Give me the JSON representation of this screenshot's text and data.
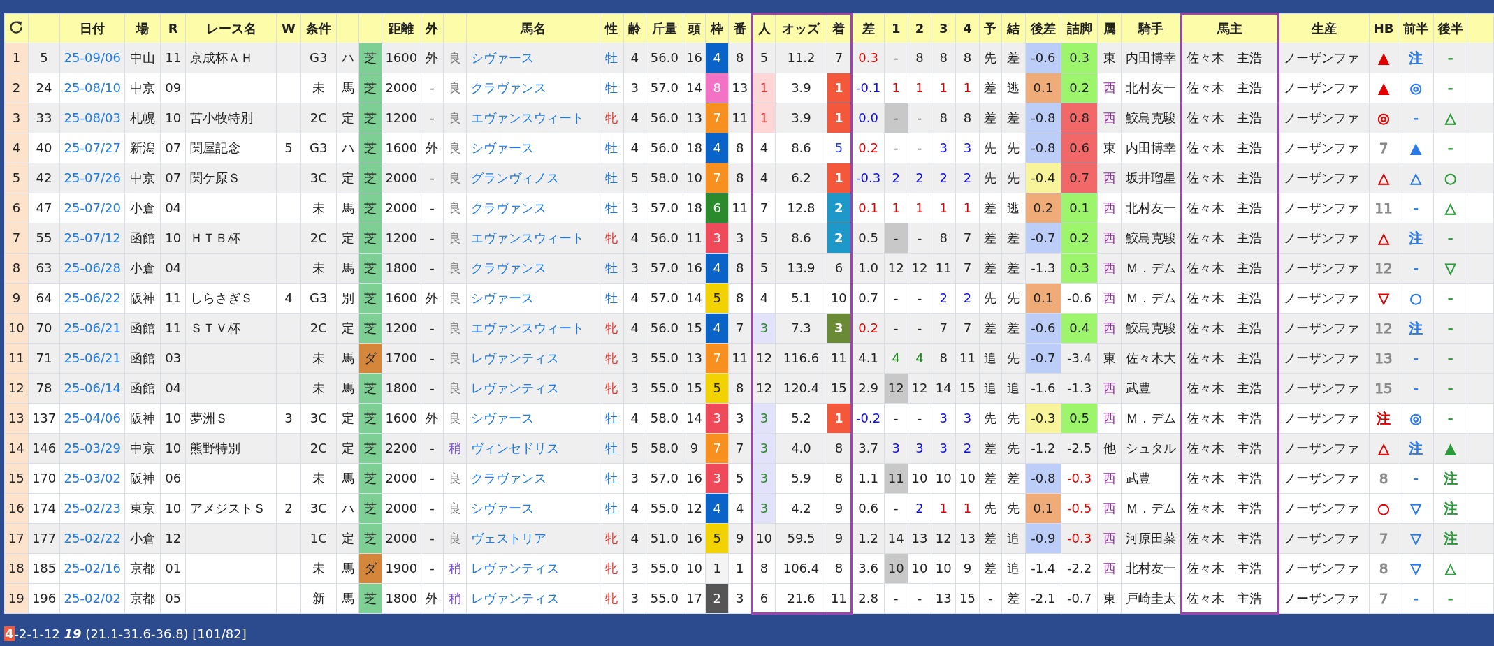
{
  "columns": [
    {
      "kind": "index",
      "highlighted": false
    },
    {
      "kind": "cell",
      "highlighted": false
    },
    {
      "label": "日付",
      "kind": "date-link",
      "highlighted": false
    },
    {
      "label": "場",
      "kind": "cell",
      "highlighted": false
    },
    {
      "label": "R",
      "kind": "cell",
      "highlighted": false
    },
    {
      "label": "レース名",
      "kind": "name",
      "highlighted": false
    },
    {
      "label": "W",
      "kind": "cell",
      "highlighted": false
    },
    {
      "label": "条件",
      "kind": "cell",
      "highlighted": false
    },
    {
      "kind": "cell",
      "highlighted": false
    },
    {
      "kind": "cell",
      "highlighted": false
    },
    {
      "label": "距離",
      "kind": "cell",
      "highlighted": false
    },
    {
      "label": "外",
      "kind": "cell",
      "highlighted": false
    },
    {
      "kind": "cell",
      "highlighted": false
    },
    {
      "label": "馬名",
      "kind": "horse-link",
      "highlighted": false
    },
    {
      "label": "性",
      "kind": "cell",
      "highlighted": false
    },
    {
      "label": "齢",
      "kind": "cell",
      "highlighted": false
    },
    {
      "label": "斤量",
      "kind": "cell",
      "highlighted": false
    },
    {
      "label": "頭",
      "kind": "cell",
      "highlighted": false
    },
    {
      "label": "枠",
      "kind": "cell",
      "highlighted": false
    },
    {
      "label": "番",
      "kind": "cell",
      "highlighted": false
    },
    {
      "label": "人",
      "kind": "cell",
      "highlighted": true
    },
    {
      "label": "オッズ",
      "kind": "cell",
      "highlighted": true
    },
    {
      "label": "着",
      "kind": "cell",
      "highlighted": true
    },
    {
      "label": "差",
      "kind": "cell",
      "highlighted": false
    },
    {
      "label": "1",
      "kind": "cell",
      "highlighted": false
    },
    {
      "label": "2",
      "kind": "cell",
      "highlighted": false
    },
    {
      "label": "3",
      "kind": "cell",
      "highlighted": false
    },
    {
      "label": "4",
      "kind": "cell",
      "highlighted": false
    },
    {
      "label": "予",
      "kind": "cell",
      "highlighted": false
    },
    {
      "label": "結",
      "kind": "cell",
      "highlighted": false
    },
    {
      "label": "後差",
      "kind": "cell",
      "highlighted": false
    },
    {
      "label": "詰脚",
      "kind": "cell",
      "highlighted": false
    },
    {
      "label": "属",
      "kind": "cell",
      "highlighted": false
    },
    {
      "label": "騎手",
      "kind": "name",
      "highlighted": false
    },
    {
      "label": "馬主",
      "kind": "name",
      "highlighted": true
    },
    {
      "label": "生産",
      "kind": "name",
      "highlighted": false
    },
    {
      "label": "HB",
      "kind": "symbol",
      "highlighted": false
    },
    {
      "label": "前半",
      "kind": "symbol",
      "highlighted": false
    },
    {
      "label": "後半",
      "kind": "symbol",
      "highlighted": false
    }
  ],
  "rows": [
    {
      "shaded": true,
      "cells": [
        "1",
        "5",
        "25-09/06",
        "中山",
        "11",
        "京成杯ＡＨ",
        null,
        "G3",
        "ハ",
        {
          "text": "芝",
          "fill": {
            "color": "#7dcf94"
          }
        },
        "1600",
        "外",
        {
          "text": "良",
          "color": "#777777"
        },
        "シヴァース",
        {
          "text": "牡",
          "color": "#1a73e8"
        },
        "4",
        "56.0",
        "16",
        {
          "text": "4",
          "kind": "inverse",
          "fill": {
            "color": "#0a63c9"
          }
        },
        "8",
        "5",
        "11.2",
        "7",
        {
          "text": "0.3",
          "color": "#e00000"
        },
        "-",
        "8",
        "8",
        "8",
        "先",
        "差",
        {
          "text": "-0.6",
          "fill": {
            "color": "#bccdf7"
          }
        },
        {
          "text": "0.3",
          "fill": {
            "color": "#9cf56a"
          }
        },
        "東",
        "内田博幸",
        "佐々木　主浩",
        "ノーザンファ",
        {
          "text": "▲",
          "color": "#e00000"
        },
        {
          "text": "注",
          "color": "#2a7ae8"
        },
        {
          "text": "-",
          "color": "#2a9a3a"
        }
      ]
    },
    {
      "shaded": false,
      "cells": [
        "2",
        "24",
        "25-08/10",
        "中京",
        "09",
        null,
        null,
        "未",
        "馬",
        {
          "text": "芝",
          "fill": {
            "color": "#7dcf94"
          }
        },
        "2000",
        "-",
        {
          "text": "良",
          "color": "#777777"
        },
        "クラヴァンス",
        {
          "text": "牡",
          "color": "#1a73e8"
        },
        "3",
        "57.0",
        "14",
        {
          "text": "8",
          "kind": "inverse",
          "fill": {
            "color": "#f472c6"
          }
        },
        "13",
        {
          "text": "1",
          "color": "#e53935",
          "fill": {
            "color": "#ffd6d6"
          }
        },
        "3.9",
        {
          "text": "1",
          "kind": "inverse",
          "fill": {
            "color": "#f4583a"
          }
        },
        {
          "text": "-0.1",
          "color": "#1010e0"
        },
        {
          "text": "1",
          "color": "#e00000"
        },
        {
          "text": "1",
          "color": "#e00000"
        },
        {
          "text": "1",
          "color": "#e00000"
        },
        {
          "text": "1",
          "color": "#e00000"
        },
        "差",
        "逃",
        {
          "text": "0.1",
          "fill": {
            "color": "#f0ac78"
          }
        },
        {
          "text": "0.2",
          "fill": {
            "color": "#9cf56a"
          }
        },
        {
          "text": "西",
          "color": "#8e2f9a"
        },
        "北村友一",
        "佐々木　主浩",
        "ノーザンファ",
        {
          "text": "▲",
          "color": "#e00000"
        },
        {
          "text": "◎",
          "color": "#2a7ae8"
        },
        {
          "text": "-",
          "color": "#2a9a3a"
        }
      ]
    },
    {
      "shaded": true,
      "cells": [
        "3",
        "33",
        "25-08/03",
        "札幌",
        "10",
        "苫小牧特別",
        null,
        "2C",
        "定",
        {
          "text": "芝",
          "fill": {
            "color": "#7dcf94"
          }
        },
        "1200",
        "-",
        {
          "text": "良",
          "color": "#777777"
        },
        "エヴァンスウィート",
        {
          "text": "牝",
          "color": "#e53935"
        },
        "4",
        "56.0",
        "13",
        {
          "text": "7",
          "kind": "inverse",
          "fill": {
            "color": "#f7901e"
          }
        },
        "11",
        {
          "text": "1",
          "color": "#e53935",
          "fill": {
            "color": "#ffd6d6"
          }
        },
        "3.9",
        {
          "text": "1",
          "kind": "inverse",
          "fill": {
            "color": "#f4583a"
          }
        },
        {
          "text": "0.0",
          "color": "#1010e0"
        },
        {
          "text": "-",
          "fill": {
            "color": "#c8c8c8"
          }
        },
        "-",
        "8",
        "8",
        "差",
        "差",
        {
          "text": "-0.8",
          "fill": {
            "color": "#bccdf7"
          }
        },
        {
          "text": "0.8",
          "fill": {
            "color": "#f26868"
          }
        },
        {
          "text": "西",
          "color": "#8e2f9a"
        },
        "鮫島克駿",
        "佐々木　主浩",
        "ノーザンファ",
        {
          "text": "◎",
          "color": "#e00000"
        },
        {
          "text": "-",
          "color": "#2a7ae8"
        },
        {
          "text": "△",
          "color": "#2a9a3a"
        }
      ]
    },
    {
      "shaded": false,
      "cells": [
        "4",
        "40",
        "25-07/27",
        "新潟",
        "07",
        "関屋記念",
        "5",
        "G3",
        "ハ",
        {
          "text": "芝",
          "fill": {
            "color": "#7dcf94"
          }
        },
        "1600",
        "外",
        {
          "text": "良",
          "color": "#777777"
        },
        "シヴァース",
        {
          "text": "牡",
          "color": "#1a73e8"
        },
        "4",
        "56.0",
        "18",
        {
          "text": "4",
          "kind": "inverse",
          "fill": {
            "color": "#0a63c9"
          }
        },
        "8",
        "4",
        "8.6",
        {
          "text": "5",
          "color": "#2a3fd6"
        },
        {
          "text": "0.2",
          "color": "#e00000"
        },
        "-",
        "-",
        {
          "text": "3",
          "color": "#1010e0"
        },
        {
          "text": "3",
          "color": "#1010e0"
        },
        "先",
        "先",
        {
          "text": "-0.8",
          "fill": {
            "color": "#bccdf7"
          }
        },
        {
          "text": "0.6",
          "fill": {
            "color": "#f26868"
          }
        },
        "東",
        "内田博幸",
        "佐々木　主浩",
        "ノーザンファ",
        {
          "text": "7",
          "color": "#888888"
        },
        {
          "text": "▲",
          "color": "#2a7ae8"
        },
        {
          "text": "-",
          "color": "#2a9a3a"
        }
      ]
    },
    {
      "shaded": true,
      "cells": [
        "5",
        "42",
        "25-07/26",
        "中京",
        "07",
        "関ケ原Ｓ",
        null,
        "3C",
        "定",
        {
          "text": "芝",
          "fill": {
            "color": "#7dcf94"
          }
        },
        "2000",
        "-",
        {
          "text": "良",
          "color": "#777777"
        },
        "グランヴィノス",
        {
          "text": "牡",
          "color": "#1a73e8"
        },
        "5",
        "58.0",
        "10",
        {
          "text": "7",
          "kind": "inverse",
          "fill": {
            "color": "#f7901e"
          }
        },
        "8",
        "4",
        "6.2",
        {
          "text": "1",
          "kind": "inverse",
          "fill": {
            "color": "#f4583a"
          }
        },
        {
          "text": "-0.3",
          "color": "#1010e0"
        },
        {
          "text": "2",
          "color": "#1010e0"
        },
        {
          "text": "2",
          "color": "#1010e0"
        },
        {
          "text": "2",
          "color": "#1010e0"
        },
        {
          "text": "2",
          "color": "#1010e0"
        },
        "先",
        "先",
        {
          "text": "-0.4",
          "fill": {
            "color": "#f7f49b"
          }
        },
        {
          "text": "0.7",
          "fill": {
            "color": "#f26868"
          }
        },
        {
          "text": "西",
          "color": "#8e2f9a"
        },
        "坂井瑠星",
        "佐々木　主浩",
        "ノーザンファ",
        {
          "text": "△",
          "color": "#e00000"
        },
        {
          "text": "△",
          "color": "#2a7ae8"
        },
        {
          "text": "○",
          "color": "#2a9a3a"
        }
      ]
    },
    {
      "shaded": false,
      "cells": [
        "6",
        "47",
        "25-07/20",
        "小倉",
        "04",
        null,
        null,
        "未",
        "馬",
        {
          "text": "芝",
          "fill": {
            "color": "#7dcf94"
          }
        },
        "2000",
        "-",
        {
          "text": "良",
          "color": "#777777"
        },
        "クラヴァンス",
        {
          "text": "牡",
          "color": "#1a73e8"
        },
        "3",
        "57.0",
        "18",
        {
          "text": "6",
          "kind": "inverse",
          "fill": {
            "color": "#2b8a2b"
          }
        },
        "11",
        "7",
        "12.8",
        {
          "text": "2",
          "kind": "inverse",
          "fill": {
            "color": "#1e97c9"
          }
        },
        {
          "text": "0.1",
          "color": "#e00000"
        },
        {
          "text": "1",
          "color": "#e00000"
        },
        {
          "text": "1",
          "color": "#e00000"
        },
        {
          "text": "1",
          "color": "#e00000"
        },
        {
          "text": "1",
          "color": "#e00000"
        },
        "差",
        "逃",
        {
          "text": "0.2",
          "fill": {
            "color": "#f0ac78"
          }
        },
        {
          "text": "0.1",
          "fill": {
            "color": "#9cf56a"
          }
        },
        {
          "text": "西",
          "color": "#8e2f9a"
        },
        "北村友一",
        "佐々木　主浩",
        "ノーザンファ",
        {
          "text": "11",
          "color": "#888888"
        },
        {
          "text": "-",
          "color": "#2a7ae8"
        },
        {
          "text": "△",
          "color": "#2a9a3a"
        }
      ]
    },
    {
      "shaded": true,
      "cells": [
        "7",
        "55",
        "25-07/12",
        "函館",
        "10",
        "ＨＴＢ杯",
        null,
        "2C",
        "定",
        {
          "text": "芝",
          "fill": {
            "color": "#7dcf94"
          }
        },
        "1200",
        "-",
        {
          "text": "良",
          "color": "#777777"
        },
        "エヴァンスウィート",
        {
          "text": "牝",
          "color": "#e53935"
        },
        "4",
        "56.0",
        "11",
        {
          "text": "3",
          "kind": "inverse",
          "fill": {
            "color": "#ef4a5a"
          }
        },
        "3",
        "5",
        "8.6",
        {
          "text": "2",
          "kind": "inverse",
          "fill": {
            "color": "#1e97c9"
          }
        },
        "0.5",
        {
          "text": "-",
          "fill": {
            "color": "#c8c8c8"
          }
        },
        "-",
        "8",
        "7",
        "差",
        "差",
        {
          "text": "-0.7",
          "fill": {
            "color": "#bccdf7"
          }
        },
        {
          "text": "0.2",
          "fill": {
            "color": "#9cf56a"
          }
        },
        {
          "text": "西",
          "color": "#8e2f9a"
        },
        "鮫島克駿",
        "佐々木　主浩",
        "ノーザンファ",
        {
          "text": "△",
          "color": "#e00000"
        },
        {
          "text": "注",
          "color": "#2a7ae8"
        },
        {
          "text": "-",
          "color": "#2a9a3a"
        }
      ]
    },
    {
      "shaded": true,
      "cells": [
        "8",
        "63",
        "25-06/28",
        "小倉",
        "04",
        null,
        null,
        "未",
        "馬",
        {
          "text": "芝",
          "fill": {
            "color": "#7dcf94"
          }
        },
        "1800",
        "-",
        {
          "text": "良",
          "color": "#777777"
        },
        "クラヴァンス",
        {
          "text": "牡",
          "color": "#1a73e8"
        },
        "3",
        "57.0",
        "16",
        {
          "text": "4",
          "kind": "inverse",
          "fill": {
            "color": "#0a63c9"
          }
        },
        "8",
        "5",
        "13.9",
        "6",
        "1.0",
        "12",
        "12",
        "11",
        "7",
        "差",
        "差",
        "-1.3",
        {
          "text": "0.3",
          "fill": {
            "color": "#9cf56a"
          }
        },
        {
          "text": "西",
          "color": "#8e2f9a"
        },
        "Ｍ．デム",
        "佐々木　主浩",
        "ノーザンファ",
        {
          "text": "12",
          "color": "#888888"
        },
        {
          "text": "-",
          "color": "#2a7ae8"
        },
        {
          "text": "▽",
          "color": "#2a9a3a"
        }
      ]
    },
    {
      "shaded": false,
      "cells": [
        "9",
        "64",
        "25-06/22",
        "阪神",
        "11",
        "しらさぎＳ",
        "4",
        "G3",
        "別",
        {
          "text": "芝",
          "fill": {
            "color": "#7dcf94"
          }
        },
        "1600",
        "外",
        {
          "text": "良",
          "color": "#777777"
        },
        "シヴァース",
        {
          "text": "牡",
          "color": "#1a73e8"
        },
        "4",
        "57.0",
        "14",
        {
          "text": "5",
          "fill": {
            "color": "#f2d300"
          }
        },
        "8",
        "4",
        "5.1",
        "10",
        "0.7",
        "-",
        "-",
        {
          "text": "2",
          "color": "#1010e0"
        },
        {
          "text": "2",
          "color": "#1010e0"
        },
        "先",
        "先",
        {
          "text": "0.1",
          "fill": {
            "color": "#f0ac78"
          }
        },
        "-0.6",
        {
          "text": "西",
          "color": "#8e2f9a"
        },
        "Ｍ．デム",
        "佐々木　主浩",
        "ノーザンファ",
        {
          "text": "▽",
          "color": "#e00000"
        },
        {
          "text": "○",
          "color": "#2a7ae8"
        },
        {
          "text": "-",
          "color": "#2a9a3a"
        }
      ]
    },
    {
      "shaded": true,
      "cells": [
        "10",
        "70",
        "25-06/21",
        "函館",
        "11",
        "ＳＴＶ杯",
        null,
        "2C",
        "定",
        {
          "text": "芝",
          "fill": {
            "color": "#7dcf94"
          }
        },
        "1200",
        "-",
        {
          "text": "良",
          "color": "#777777"
        },
        "エヴァンスウィート",
        {
          "text": "牝",
          "color": "#e53935"
        },
        "4",
        "56.0",
        "15",
        {
          "text": "4",
          "kind": "inverse",
          "fill": {
            "color": "#0a63c9"
          }
        },
        "7",
        {
          "text": "3",
          "color": "#2b8a2b",
          "fill": {
            "color": "#e2e2fa"
          }
        },
        "7.3",
        {
          "text": "3",
          "kind": "inverse",
          "fill": {
            "color": "#6a8a36"
          }
        },
        {
          "text": "0.2",
          "color": "#e00000"
        },
        "-",
        "-",
        "7",
        "7",
        "差",
        "差",
        {
          "text": "-0.6",
          "fill": {
            "color": "#bccdf7"
          }
        },
        {
          "text": "0.4",
          "fill": {
            "color": "#9cf56a"
          }
        },
        {
          "text": "西",
          "color": "#8e2f9a"
        },
        "鮫島克駿",
        "佐々木　主浩",
        "ノーザンファ",
        {
          "text": "12",
          "color": "#888888"
        },
        {
          "text": "注",
          "color": "#2a7ae8"
        },
        {
          "text": "-",
          "color": "#2a9a3a"
        }
      ]
    },
    {
      "shaded": true,
      "cells": [
        "11",
        "71",
        "25-06/21",
        "函館",
        "03",
        null,
        null,
        "未",
        "馬",
        {
          "text": "ダ",
          "fill": {
            "color": "#d4873a"
          }
        },
        "1700",
        "-",
        {
          "text": "良",
          "color": "#777777"
        },
        "レヴァンティス",
        {
          "text": "牝",
          "color": "#e53935"
        },
        "3",
        "55.0",
        "13",
        {
          "text": "7",
          "kind": "inverse",
          "fill": {
            "color": "#f7901e"
          }
        },
        "11",
        "12",
        "116.6",
        "11",
        "4.1",
        {
          "text": "4",
          "color": "#1a8a1a"
        },
        {
          "text": "4",
          "color": "#1a8a1a"
        },
        "8",
        "11",
        "追",
        "先",
        {
          "text": "-0.7",
          "fill": {
            "color": "#bccdf7"
          }
        },
        "-3.4",
        "東",
        "佐々木大",
        "佐々木　主浩",
        "ノーザンファ",
        {
          "text": "13",
          "color": "#888888"
        },
        {
          "text": "-",
          "color": "#2a7ae8"
        },
        {
          "text": "-",
          "color": "#2a9a3a"
        }
      ]
    },
    {
      "shaded": true,
      "cells": [
        "12",
        "78",
        "25-06/14",
        "函館",
        "04",
        null,
        null,
        "未",
        "馬",
        {
          "text": "芝",
          "fill": {
            "color": "#7dcf94"
          }
        },
        "1800",
        "-",
        {
          "text": "良",
          "color": "#777777"
        },
        "レヴァンティス",
        {
          "text": "牝",
          "color": "#e53935"
        },
        "3",
        "55.0",
        "15",
        {
          "text": "5",
          "fill": {
            "color": "#f2d300"
          }
        },
        "8",
        "12",
        "120.4",
        "15",
        "2.9",
        {
          "text": "12",
          "fill": {
            "color": "#c8c8c8"
          }
        },
        "12",
        "14",
        "15",
        "追",
        "追",
        "-1.6",
        "-1.3",
        {
          "text": "西",
          "color": "#8e2f9a"
        },
        "武豊",
        "佐々木　主浩",
        "ノーザンファ",
        {
          "text": "15",
          "color": "#888888"
        },
        {
          "text": "-",
          "color": "#2a7ae8"
        },
        {
          "text": "-",
          "color": "#2a9a3a"
        }
      ]
    },
    {
      "shaded": false,
      "cells": [
        "13",
        "137",
        "25-04/06",
        "阪神",
        "10",
        "夢洲Ｓ",
        "3",
        "3C",
        "定",
        {
          "text": "芝",
          "fill": {
            "color": "#7dcf94"
          }
        },
        "1600",
        "外",
        {
          "text": "良",
          "color": "#777777"
        },
        "シヴァース",
        {
          "text": "牡",
          "color": "#1a73e8"
        },
        "4",
        "58.0",
        "14",
        {
          "text": "3",
          "kind": "inverse",
          "fill": {
            "color": "#ef4a5a"
          }
        },
        "3",
        {
          "text": "3",
          "color": "#2b8a2b",
          "fill": {
            "color": "#e2e2fa"
          }
        },
        "5.2",
        {
          "text": "1",
          "kind": "inverse",
          "fill": {
            "color": "#f4583a"
          }
        },
        {
          "text": "-0.2",
          "color": "#1010e0"
        },
        "-",
        "-",
        {
          "text": "3",
          "color": "#1010e0"
        },
        {
          "text": "3",
          "color": "#1010e0"
        },
        "先",
        "先",
        {
          "text": "-0.3",
          "fill": {
            "color": "#f7f49b"
          }
        },
        {
          "text": "0.5",
          "fill": {
            "color": "#9cf56a"
          }
        },
        {
          "text": "西",
          "color": "#8e2f9a"
        },
        "Ｍ．デム",
        "佐々木　主浩",
        "ノーザンファ",
        {
          "text": "注",
          "color": "#e00000"
        },
        {
          "text": "◎",
          "color": "#2a7ae8"
        },
        {
          "text": "-",
          "color": "#2a9a3a"
        }
      ]
    },
    {
      "shaded": true,
      "cells": [
        "14",
        "146",
        "25-03/29",
        "中京",
        "10",
        "熊野特別",
        null,
        "2C",
        "定",
        {
          "text": "芝",
          "fill": {
            "color": "#7dcf94"
          }
        },
        "2200",
        "-",
        {
          "text": "稍",
          "color": "#7b52d6"
        },
        "ヴィンセドリス",
        {
          "text": "牡",
          "color": "#1a73e8"
        },
        "5",
        "58.0",
        "9",
        {
          "text": "7",
          "kind": "inverse",
          "fill": {
            "color": "#f7901e"
          }
        },
        "7",
        {
          "text": "3",
          "color": "#2b8a2b",
          "fill": {
            "color": "#e2e2fa"
          }
        },
        "4.0",
        "8",
        "3.7",
        {
          "text": "3",
          "color": "#1010e0"
        },
        {
          "text": "3",
          "color": "#1010e0"
        },
        {
          "text": "3",
          "color": "#1010e0"
        },
        {
          "text": "2",
          "color": "#1010e0"
        },
        "差",
        "先",
        "-1.2",
        "-2.5",
        "他",
        "シュタル",
        "佐々木　主浩",
        "ノーザンファ",
        {
          "text": "△",
          "color": "#e00000"
        },
        {
          "text": "注",
          "color": "#2a7ae8"
        },
        {
          "text": "▲",
          "color": "#2a9a3a"
        }
      ]
    },
    {
      "shaded": false,
      "cells": [
        "15",
        "170",
        "25-03/02",
        "阪神",
        "06",
        null,
        null,
        "未",
        "馬",
        {
          "text": "芝",
          "fill": {
            "color": "#7dcf94"
          }
        },
        "2000",
        "-",
        {
          "text": "良",
          "color": "#777777"
        },
        "クラヴァンス",
        {
          "text": "牡",
          "color": "#1a73e8"
        },
        "3",
        "57.0",
        "16",
        {
          "text": "3",
          "kind": "inverse",
          "fill": {
            "color": "#ef4a5a"
          }
        },
        "5",
        {
          "text": "3",
          "color": "#2b8a2b",
          "fill": {
            "color": "#e2e2fa"
          }
        },
        "5.9",
        "8",
        "1.1",
        {
          "text": "11",
          "fill": {
            "color": "#c8c8c8"
          }
        },
        "10",
        "10",
        "10",
        "差",
        "差",
        {
          "text": "-0.8",
          "fill": {
            "color": "#bccdf7"
          }
        },
        {
          "text": "-0.3",
          "color": "#e00000"
        },
        {
          "text": "西",
          "color": "#8e2f9a"
        },
        "武豊",
        "佐々木　主浩",
        "ノーザンファ",
        {
          "text": "8",
          "color": "#888888"
        },
        {
          "text": "-",
          "color": "#2a7ae8"
        },
        {
          "text": "注",
          "color": "#2a9a3a"
        }
      ]
    },
    {
      "shaded": false,
      "cells": [
        "16",
        "174",
        "25-02/23",
        "東京",
        "10",
        "アメジストＳ",
        "2",
        "3C",
        "ハ",
        {
          "text": "芝",
          "fill": {
            "color": "#7dcf94"
          }
        },
        "2000",
        "-",
        {
          "text": "良",
          "color": "#777777"
        },
        "シヴァース",
        {
          "text": "牡",
          "color": "#1a73e8"
        },
        "4",
        "55.0",
        "12",
        {
          "text": "4",
          "kind": "inverse",
          "fill": {
            "color": "#0a63c9"
          }
        },
        "4",
        {
          "text": "3",
          "color": "#2b8a2b",
          "fill": {
            "color": "#e2e2fa"
          }
        },
        "4.2",
        "9",
        "0.6",
        "-",
        {
          "text": "2",
          "color": "#1010e0"
        },
        {
          "text": "1",
          "color": "#e00000"
        },
        {
          "text": "1",
          "color": "#e00000"
        },
        "先",
        "先",
        {
          "text": "0.1",
          "fill": {
            "color": "#f0ac78"
          }
        },
        {
          "text": "-0.5",
          "color": "#e00000"
        },
        {
          "text": "西",
          "color": "#8e2f9a"
        },
        "Ｍ．デム",
        "佐々木　主浩",
        "ノーザンファ",
        {
          "text": "○",
          "color": "#e00000"
        },
        {
          "text": "▽",
          "color": "#2a7ae8"
        },
        {
          "text": "注",
          "color": "#2a9a3a"
        }
      ]
    },
    {
      "shaded": true,
      "cells": [
        "17",
        "177",
        "25-02/22",
        "小倉",
        "12",
        null,
        null,
        "1C",
        "定",
        {
          "text": "芝",
          "fill": {
            "color": "#7dcf94"
          }
        },
        "2000",
        "-",
        {
          "text": "良",
          "color": "#777777"
        },
        "ヴェストリア",
        {
          "text": "牝",
          "color": "#e53935"
        },
        "4",
        "51.0",
        "16",
        {
          "text": "5",
          "fill": {
            "color": "#f2d300"
          }
        },
        "9",
        "10",
        "59.5",
        "9",
        "1.2",
        "14",
        "13",
        "12",
        "13",
        "差",
        "追",
        {
          "text": "-0.9",
          "fill": {
            "color": "#bccdf7"
          }
        },
        {
          "text": "-0.3",
          "color": "#e00000"
        },
        {
          "text": "西",
          "color": "#8e2f9a"
        },
        "河原田菜",
        "佐々木　主浩",
        "ノーザンファ",
        {
          "text": "7",
          "color": "#888888"
        },
        {
          "text": "▽",
          "color": "#2a7ae8"
        },
        {
          "text": "注",
          "color": "#2a9a3a"
        }
      ]
    },
    {
      "shaded": false,
      "cells": [
        "18",
        "185",
        "25-02/16",
        "京都",
        "01",
        null,
        null,
        "未",
        "馬",
        {
          "text": "ダ",
          "fill": {
            "color": "#d4873a"
          }
        },
        "1900",
        "-",
        {
          "text": "稍",
          "color": "#7b52d6"
        },
        "レヴァンティス",
        {
          "text": "牝",
          "color": "#e53935"
        },
        "3",
        "55.0",
        "10",
        {
          "text": "1",
          "fill": {
            "color": "#f4f4f4"
          }
        },
        "1",
        "8",
        "106.4",
        "8",
        "3.6",
        {
          "text": "10",
          "fill": {
            "color": "#c8c8c8"
          }
        },
        "10",
        "10",
        "9",
        "差",
        "追",
        "-1.4",
        "-2.2",
        {
          "text": "西",
          "color": "#8e2f9a"
        },
        "北村友一",
        "佐々木　主浩",
        "ノーザンファ",
        {
          "text": "8",
          "color": "#888888"
        },
        {
          "text": "▽",
          "color": "#2a7ae8"
        },
        {
          "text": "△",
          "color": "#2a9a3a"
        }
      ]
    },
    {
      "shaded": false,
      "cells": [
        "19",
        "196",
        "25-02/02",
        "京都",
        "05",
        null,
        null,
        "新",
        "馬",
        {
          "text": "芝",
          "fill": {
            "color": "#7dcf94"
          }
        },
        "1800",
        "外",
        {
          "text": "稍",
          "color": "#7b52d6"
        },
        "レヴァンティス",
        {
          "text": "牝",
          "color": "#e53935"
        },
        "3",
        "55.0",
        "17",
        {
          "text": "2",
          "kind": "inverse",
          "fill": {
            "color": "#555555"
          }
        },
        "3",
        "6",
        "21.6",
        "11",
        "2.8",
        "-",
        "-",
        "13",
        "15",
        "-",
        "差",
        "-2.1",
        "-0.7",
        "東",
        "戸崎圭太",
        "佐々木　主浩",
        "ノーザンファ",
        {
          "text": "7",
          "color": "#888888"
        },
        {
          "text": "-",
          "color": "#2a7ae8"
        },
        {
          "text": "-",
          "color": "#2a9a3a"
        }
      ]
    }
  ],
  "footer": {
    "lead": "4",
    "record": "-2-1-12",
    "count": "19",
    "stats": "(21.1-31.6-36.8) [101/82]"
  }
}
